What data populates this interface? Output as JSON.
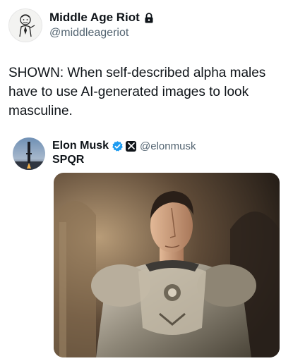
{
  "author": {
    "display_name": "Middle Age Riot",
    "handle": "@middleageriot",
    "avatar_icon": "cartoon-man-avatar",
    "protected_icon": "lock-icon"
  },
  "tweet": {
    "text": "SHOWN: When self-described alpha males\nhave to use AI-generated images to look\nmasculine."
  },
  "quoted_tweet": {
    "display_name": "Elon Musk",
    "handle": "@elonmusk",
    "text": "SPQR",
    "verified_icon": "verified-badge-icon",
    "affiliate_icon": "x-logo-icon",
    "avatar_icon": "rocket-launch-avatar",
    "media_alt": "man-in-roman-armor-image"
  },
  "colors": {
    "text": "#0f1419",
    "secondary": "#536471",
    "verified": "#1d9bf0"
  }
}
